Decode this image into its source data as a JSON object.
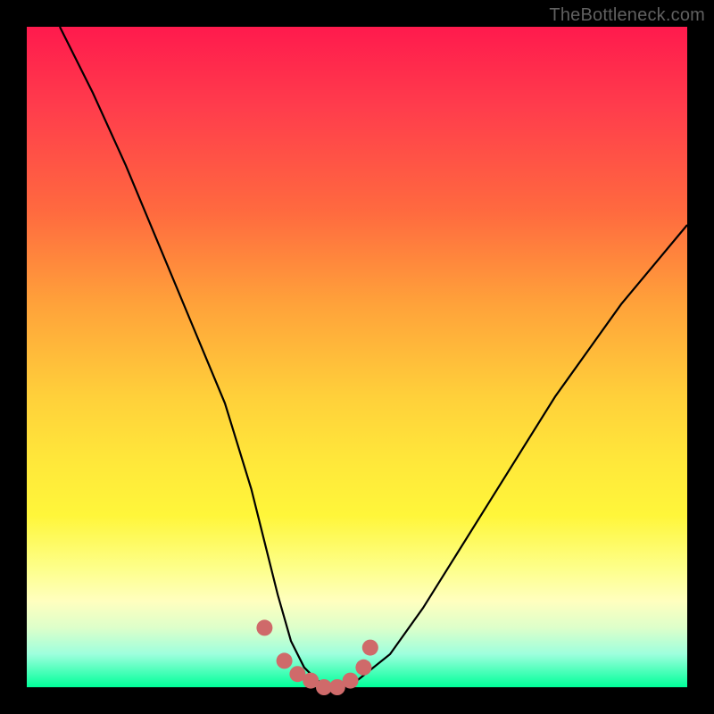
{
  "watermark": "TheBottleneck.com",
  "chart_data": {
    "type": "line",
    "title": "",
    "xlabel": "",
    "ylabel": "",
    "xlim": [
      0,
      100
    ],
    "ylim": [
      0,
      100
    ],
    "grid": false,
    "series": [
      {
        "name": "bottleneck-curve",
        "x": [
          5,
          10,
          15,
          20,
          25,
          30,
          34,
          36,
          38,
          40,
          42,
          44,
          46,
          48,
          50,
          55,
          60,
          65,
          70,
          75,
          80,
          85,
          90,
          95,
          100
        ],
        "values": [
          100,
          90,
          79,
          67,
          55,
          43,
          30,
          22,
          14,
          7,
          3,
          1,
          0,
          0,
          1,
          5,
          12,
          20,
          28,
          36,
          44,
          51,
          58,
          64,
          70
        ]
      }
    ],
    "markers": {
      "name": "bottom-salmon-points",
      "color": "#cf6a6a",
      "x": [
        36,
        39,
        41,
        43,
        45,
        47,
        49,
        51,
        52
      ],
      "values": [
        9,
        4,
        2,
        1,
        0,
        0,
        1,
        3,
        6
      ]
    },
    "color_scale": {
      "top": "#ff1a4d",
      "mid": "#ffe83a",
      "bottom": "#00ff99"
    }
  }
}
